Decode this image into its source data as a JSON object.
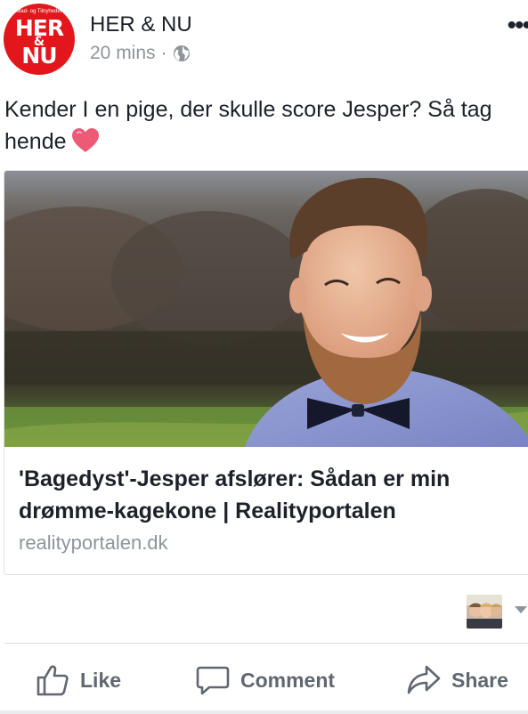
{
  "post": {
    "page_name": "HER & NU",
    "timestamp": "20 mins",
    "separator": "·",
    "privacy_icon": "globe-icon",
    "more_icon": "more-dots-icon",
    "avatar": {
      "line1": "HER",
      "amp": "&",
      "line2": "NU",
      "tagline": "Mad- og Tilnyheder"
    },
    "text": "Kender I en pige, der skulle score Jesper? Så tag hende",
    "emoji": "heart-emoji"
  },
  "link_card": {
    "title": "'Bagedyst'-Jesper afslører: Sådan er min drømme-kagekone | Realityportalen",
    "domain": "realityportalen.dk"
  },
  "actions": {
    "like_label": "Like",
    "comment_label": "Comment",
    "share_label": "Share"
  },
  "colors": {
    "brand_red": "#e3161b",
    "text_primary": "#1d2129",
    "text_secondary": "#90949c",
    "action_gray": "#606770",
    "divider": "#dadde1"
  }
}
